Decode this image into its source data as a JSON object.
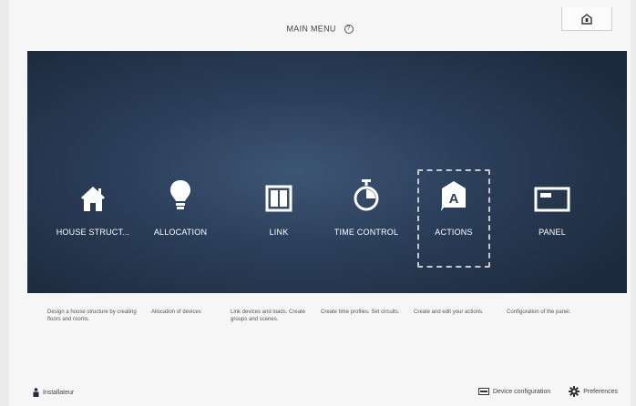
{
  "header": {
    "title": "MAIN MENU",
    "help_icon": "?"
  },
  "menu": [
    {
      "label": "HOUSE STRUCT...",
      "icon": "house-icon",
      "description": "Design a house structure by creating floors and rooms."
    },
    {
      "label": "ALLOCATION",
      "icon": "lightbulb-icon",
      "description": "Allocation of devices"
    },
    {
      "label": "LINK",
      "icon": "link-switch-icon",
      "description": "Link devices and loads. Create groups and scenes."
    },
    {
      "label": "TIME CONTROL",
      "icon": "stopwatch-icon",
      "description": "Create time profiles. Set circuits."
    },
    {
      "label": "ACTIONS",
      "icon": "actions-a-icon",
      "description": "Create and edit your actions.",
      "selected": true
    },
    {
      "label": "PANEL",
      "icon": "panel-icon",
      "description": "Configuration of the panel."
    }
  ],
  "footer": {
    "user": "Installateur",
    "device_configuration": "Device configuration",
    "preferences": "Preferences"
  },
  "colors": {
    "panel_bg": "#2b3f5a",
    "tile_text": "#ffffff",
    "page_bg": "#f6f6f6"
  }
}
